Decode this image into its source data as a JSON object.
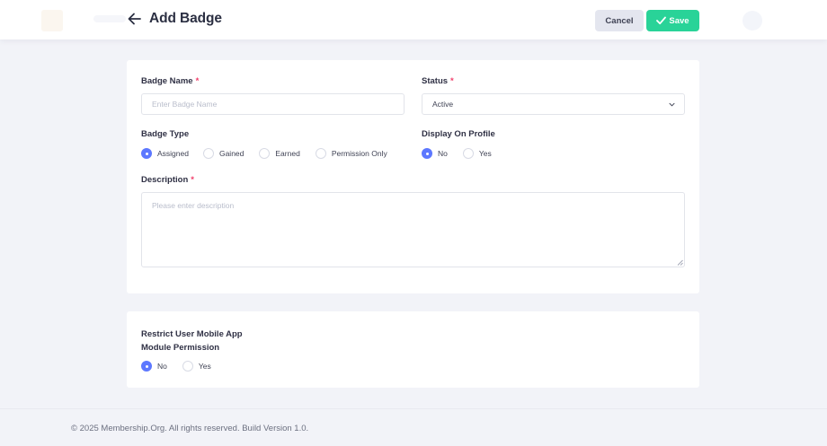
{
  "header": {
    "title": "Add Badge",
    "cancel_label": "Cancel",
    "save_label": "Save"
  },
  "form": {
    "badge_name": {
      "label": "Badge Name",
      "required": "*",
      "value": "",
      "placeholder": "Enter Badge Name"
    },
    "status": {
      "label": "Status",
      "required": "*",
      "value": "Active"
    },
    "badge_type": {
      "label": "Badge Type",
      "options": [
        "Assigned",
        "Gained",
        "Earned",
        "Permission Only"
      ],
      "selected": "Assigned"
    },
    "display_on_profile": {
      "label": "Display On Profile",
      "options": [
        "No",
        "Yes"
      ],
      "selected": "No"
    },
    "description": {
      "label": "Description",
      "required": "*",
      "value": "",
      "placeholder": "Please enter description"
    }
  },
  "restrict": {
    "label_line1": "Restrict User Mobile App",
    "label_line2": "Module Permission",
    "options": [
      "No",
      "Yes"
    ],
    "selected": "No"
  },
  "footer": {
    "text": "© 2025 Membership.Org. All rights reserved. Build Version 1.0."
  },
  "colors": {
    "primary": "#5d78ff",
    "success": "#29d398",
    "required": "#f1416c",
    "background": "#f2f3f8"
  },
  "icons": {
    "back": "arrow-left-icon",
    "save": "check-icon",
    "status_select": "chevron-down-icon"
  }
}
